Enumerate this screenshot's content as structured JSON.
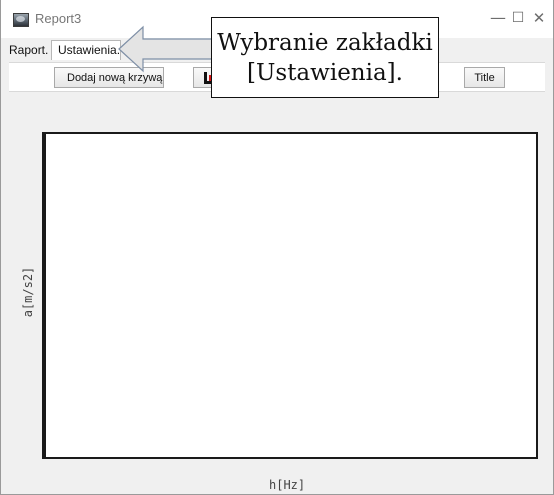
{
  "window": {
    "title": "Report3",
    "controls": {
      "minimize": "—",
      "maximize": "☐",
      "close": "✕"
    }
  },
  "menu": {
    "report_label": "Raport.",
    "tab_settings": "Ustawienia."
  },
  "toolbar": {
    "add_curve": "Dodaj nową krzywą",
    "chart_icon": "chart-icon",
    "title": "Title"
  },
  "plot": {
    "y_label": "a[m/s2]",
    "x_label": "h[Hz]"
  },
  "annotation": {
    "line1": "Wybranie zakładki",
    "line2": "[Ustawienia]."
  },
  "icons": {
    "app": "app-icon",
    "arrow": "left-arrow-icon"
  },
  "colors": {
    "background": "#f0f0f0",
    "panel": "#ffffff",
    "border": "#1a1a1a",
    "accent_red": "#d01414",
    "arrow_fill": "#e4e4e4"
  }
}
